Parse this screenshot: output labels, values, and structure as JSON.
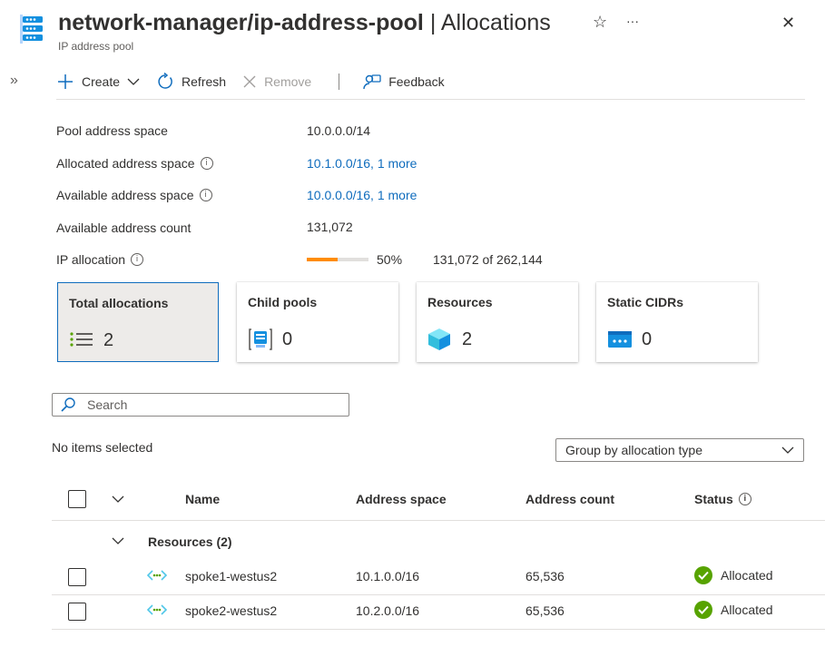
{
  "header": {
    "title_bold": "network-manager/ip-address-pool",
    "title_rest": "| Allocations",
    "subtitle": "IP address pool",
    "expand_glyph": "»",
    "star_glyph": "☆",
    "more_glyph": "···",
    "close_glyph": "✕"
  },
  "toolbar": {
    "create_label": "Create",
    "refresh_label": "Refresh",
    "remove_label": "Remove",
    "feedback_label": "Feedback"
  },
  "properties": {
    "pool_address_space": {
      "label": "Pool address space",
      "value": "10.0.0.0/14"
    },
    "allocated_address_space": {
      "label": "Allocated address space",
      "value": "10.1.0.0/16, 1 more"
    },
    "available_address_space": {
      "label": "Available address space",
      "value": "10.0.0.0/16, 1 more"
    },
    "available_address_count": {
      "label": "Available address count",
      "value": "131,072"
    },
    "ip_allocation": {
      "label": "IP allocation",
      "percent_text": "50%",
      "fraction": 0.5,
      "detail": "131,072 of 262,144"
    }
  },
  "cards": [
    {
      "title": "Total allocations",
      "count": "2",
      "icon": "list-icon"
    },
    {
      "title": "Child pools",
      "count": "0",
      "icon": "pool-icon"
    },
    {
      "title": "Resources",
      "count": "2",
      "icon": "cube-icon"
    },
    {
      "title": "Static CIDRs",
      "count": "0",
      "icon": "cidr-icon"
    }
  ],
  "search": {
    "placeholder": "Search"
  },
  "selection_text": "No items selected",
  "group_by": {
    "selected": "Group by allocation type"
  },
  "table": {
    "headers": {
      "name": "Name",
      "address_space": "Address space",
      "address_count": "Address count",
      "status": "Status"
    },
    "group_label": "Resources (2)",
    "rows": [
      {
        "name": "spoke1-westus2",
        "address_space": "10.1.0.0/16",
        "address_count": "65,536",
        "status": "Allocated"
      },
      {
        "name": "spoke2-westus2",
        "address_space": "10.2.0.0/16",
        "address_count": "65,536",
        "status": "Allocated"
      }
    ]
  },
  "colors": {
    "accent": "#0f6cbd",
    "progress": "#ff8c00",
    "success": "#57a300"
  }
}
